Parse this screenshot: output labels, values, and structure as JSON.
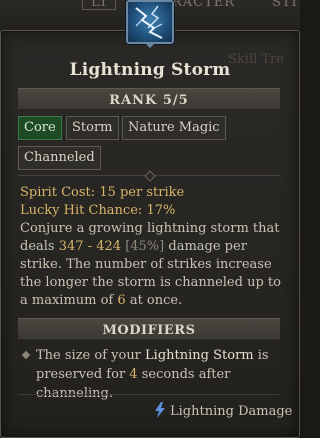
{
  "top_tabs": {
    "left": "LI",
    "middle": "RACTER",
    "right": "STI"
  },
  "faint_text": "Skill Tre",
  "skill": {
    "icon": "lightning-storm-icon",
    "name": "Lightning Storm",
    "rank": "RANK 5/5"
  },
  "tags": [
    {
      "label": "Core",
      "highlight": true
    },
    {
      "label": "Storm"
    },
    {
      "label": "Nature Magic"
    },
    {
      "label": "Channeled"
    }
  ],
  "stats": {
    "spirit_cost_label": "Spirit Cost:",
    "spirit_cost_value": "15 per strike",
    "lucky_hit_label": "Lucky Hit Chance:",
    "lucky_hit_value": "17%",
    "desc_1": "Conjure a growing lightning storm that deals",
    "damage_range": "347 - 424",
    "damage_pct": "[45%]",
    "desc_2": "damage per strike. The number of strikes increase the longer the storm is channeled up to a maximum of",
    "max_count": "6",
    "desc_3": "at once."
  },
  "modifiers": {
    "header": "MODIFIERS",
    "line_1": "The size of your",
    "skill_ref": "Lightning Storm",
    "line_2": "is preserved for",
    "seconds": "4",
    "line_3": "seconds after channeling."
  },
  "damage_type": {
    "icon": "lightning-bolt-icon",
    "label": "Lightning Damage"
  },
  "colors": {
    "gold": "#d9b56a",
    "core_tag": "#1f4a26",
    "panel": "#262522"
  }
}
